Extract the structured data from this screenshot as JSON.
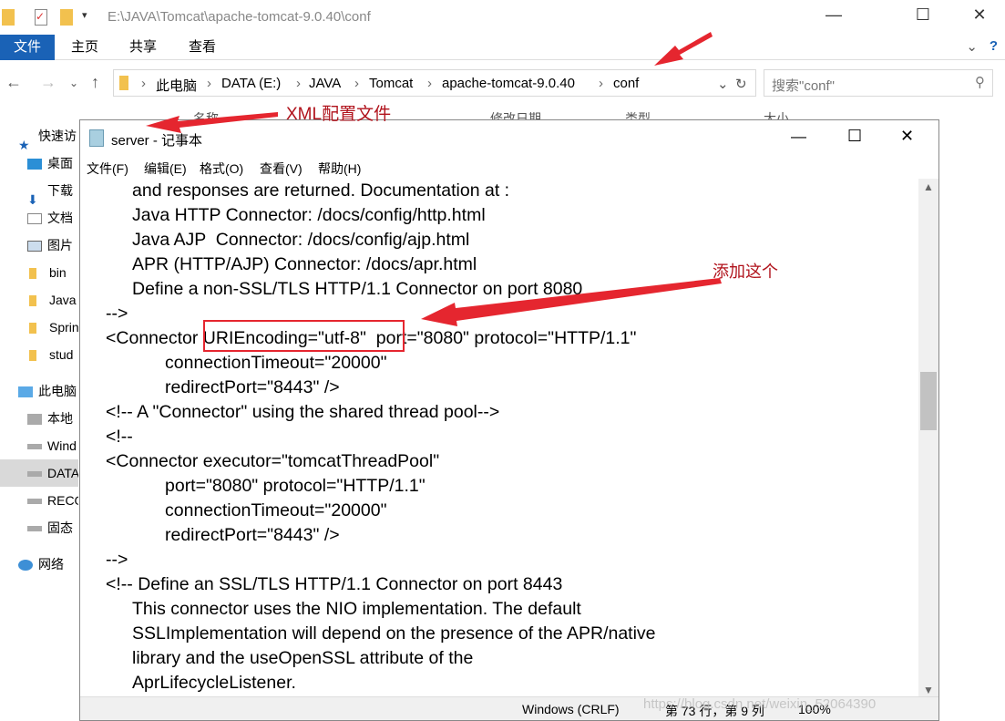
{
  "explorer": {
    "path": "E:\\JAVA\\Tomcat\\apache-tomcat-9.0.40\\conf",
    "ribbon_tabs": [
      "文件",
      "主页",
      "共享",
      "查看"
    ],
    "breadcrumb": [
      "此电脑",
      "DATA (E:)",
      "JAVA",
      "Tomcat",
      "apache-tomcat-9.0.40",
      "conf"
    ],
    "search_placeholder": "搜索\"conf\"",
    "columns": [
      "名称",
      "修改日期",
      "类型",
      "大小"
    ],
    "sidebar": [
      "快速访",
      "桌面",
      "下载",
      "文档",
      "图片",
      "bin",
      "Java",
      "Sprin",
      "stud",
      "此电脑",
      "本地",
      "Wind",
      "DATA",
      "RECO",
      "固态",
      "网络"
    ]
  },
  "notepad": {
    "title": "server - 记事本",
    "menu": [
      "文件(F)",
      "编辑(E)",
      "格式(O)",
      "查看(V)",
      "帮助(H)"
    ],
    "lines": [
      "and responses are returned. Documentation at :",
      "Java HTTP Connector: /docs/config/http.html",
      "Java AJP  Connector: /docs/config/ajp.html",
      "APR (HTTP/AJP) Connector: /docs/apr.html",
      "Define a non-SSL/TLS HTTP/1.1 Connector on port 8080",
      "-->",
      "<Connector URIEncoding=\"utf-8\"  port=\"8080\" protocol=\"HTTP/1.1\"",
      "connectionTimeout=\"20000\"",
      "redirectPort=\"8443\" />",
      "<!-- A \"Connector\" using the shared thread pool-->",
      "<!--",
      "<Connector executor=\"tomcatThreadPool\"",
      "port=\"8080\" protocol=\"HTTP/1.1\"",
      "connectionTimeout=\"20000\"",
      "redirectPort=\"8443\" />",
      "-->",
      "<!-- Define an SSL/TLS HTTP/1.1 Connector on port 8443",
      "This connector uses the NIO implementation. The default",
      "SSLImplementation will depend on the presence of the APR/native",
      "library and the useOpenSSL attribute of the",
      "AprLifecycleListener."
    ],
    "status": {
      "line_ending": "Windows (CRLF)",
      "position": "第 73 行，第 9 列",
      "zoom": "100%"
    }
  },
  "annotations": {
    "xml_label": "XML配置文件",
    "add_label": "添加这个",
    "color": "#e5262f"
  },
  "watermark": "https://blog.csdn.net/weixin_52064390"
}
